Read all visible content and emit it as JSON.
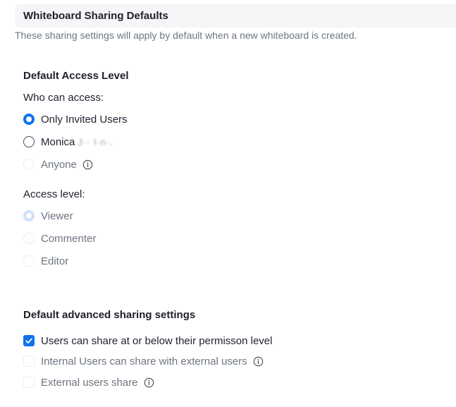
{
  "header": {
    "title": "Whiteboard Sharing Defaults",
    "description": "These sharing settings will apply by default when a new whiteboard is created."
  },
  "access_section": {
    "title": "Default Access Level",
    "who_label": "Who can access:",
    "who_options": [
      {
        "label": "Only Invited Users",
        "state": "checked"
      },
      {
        "label": "Monica",
        "redacted": "J·· l·n·.",
        "state": "unchecked"
      },
      {
        "label": "Anyone",
        "state": "disabled",
        "has_info": true
      }
    ],
    "level_label": "Access level:",
    "level_options": [
      {
        "label": "Viewer",
        "state": "checked-disabled"
      },
      {
        "label": "Commenter",
        "state": "disabled"
      },
      {
        "label": "Editor",
        "state": "disabled"
      }
    ]
  },
  "advanced_section": {
    "title": "Default advanced sharing settings",
    "options": [
      {
        "label": "Users can share at or below their permisson level",
        "state": "checked"
      },
      {
        "label": "Internal Users can share with external users",
        "state": "disabled",
        "has_info": true
      },
      {
        "label": "External users share",
        "state": "disabled",
        "has_info": true
      }
    ]
  },
  "colors": {
    "accent": "#0e72ed",
    "accent_disabled": "#cfe1fb",
    "text": "#232333",
    "muted_text": "#6e7680",
    "header_bg": "#f6f6f8"
  },
  "icons": {
    "info": "info-circle-icon",
    "check": "check-icon"
  }
}
